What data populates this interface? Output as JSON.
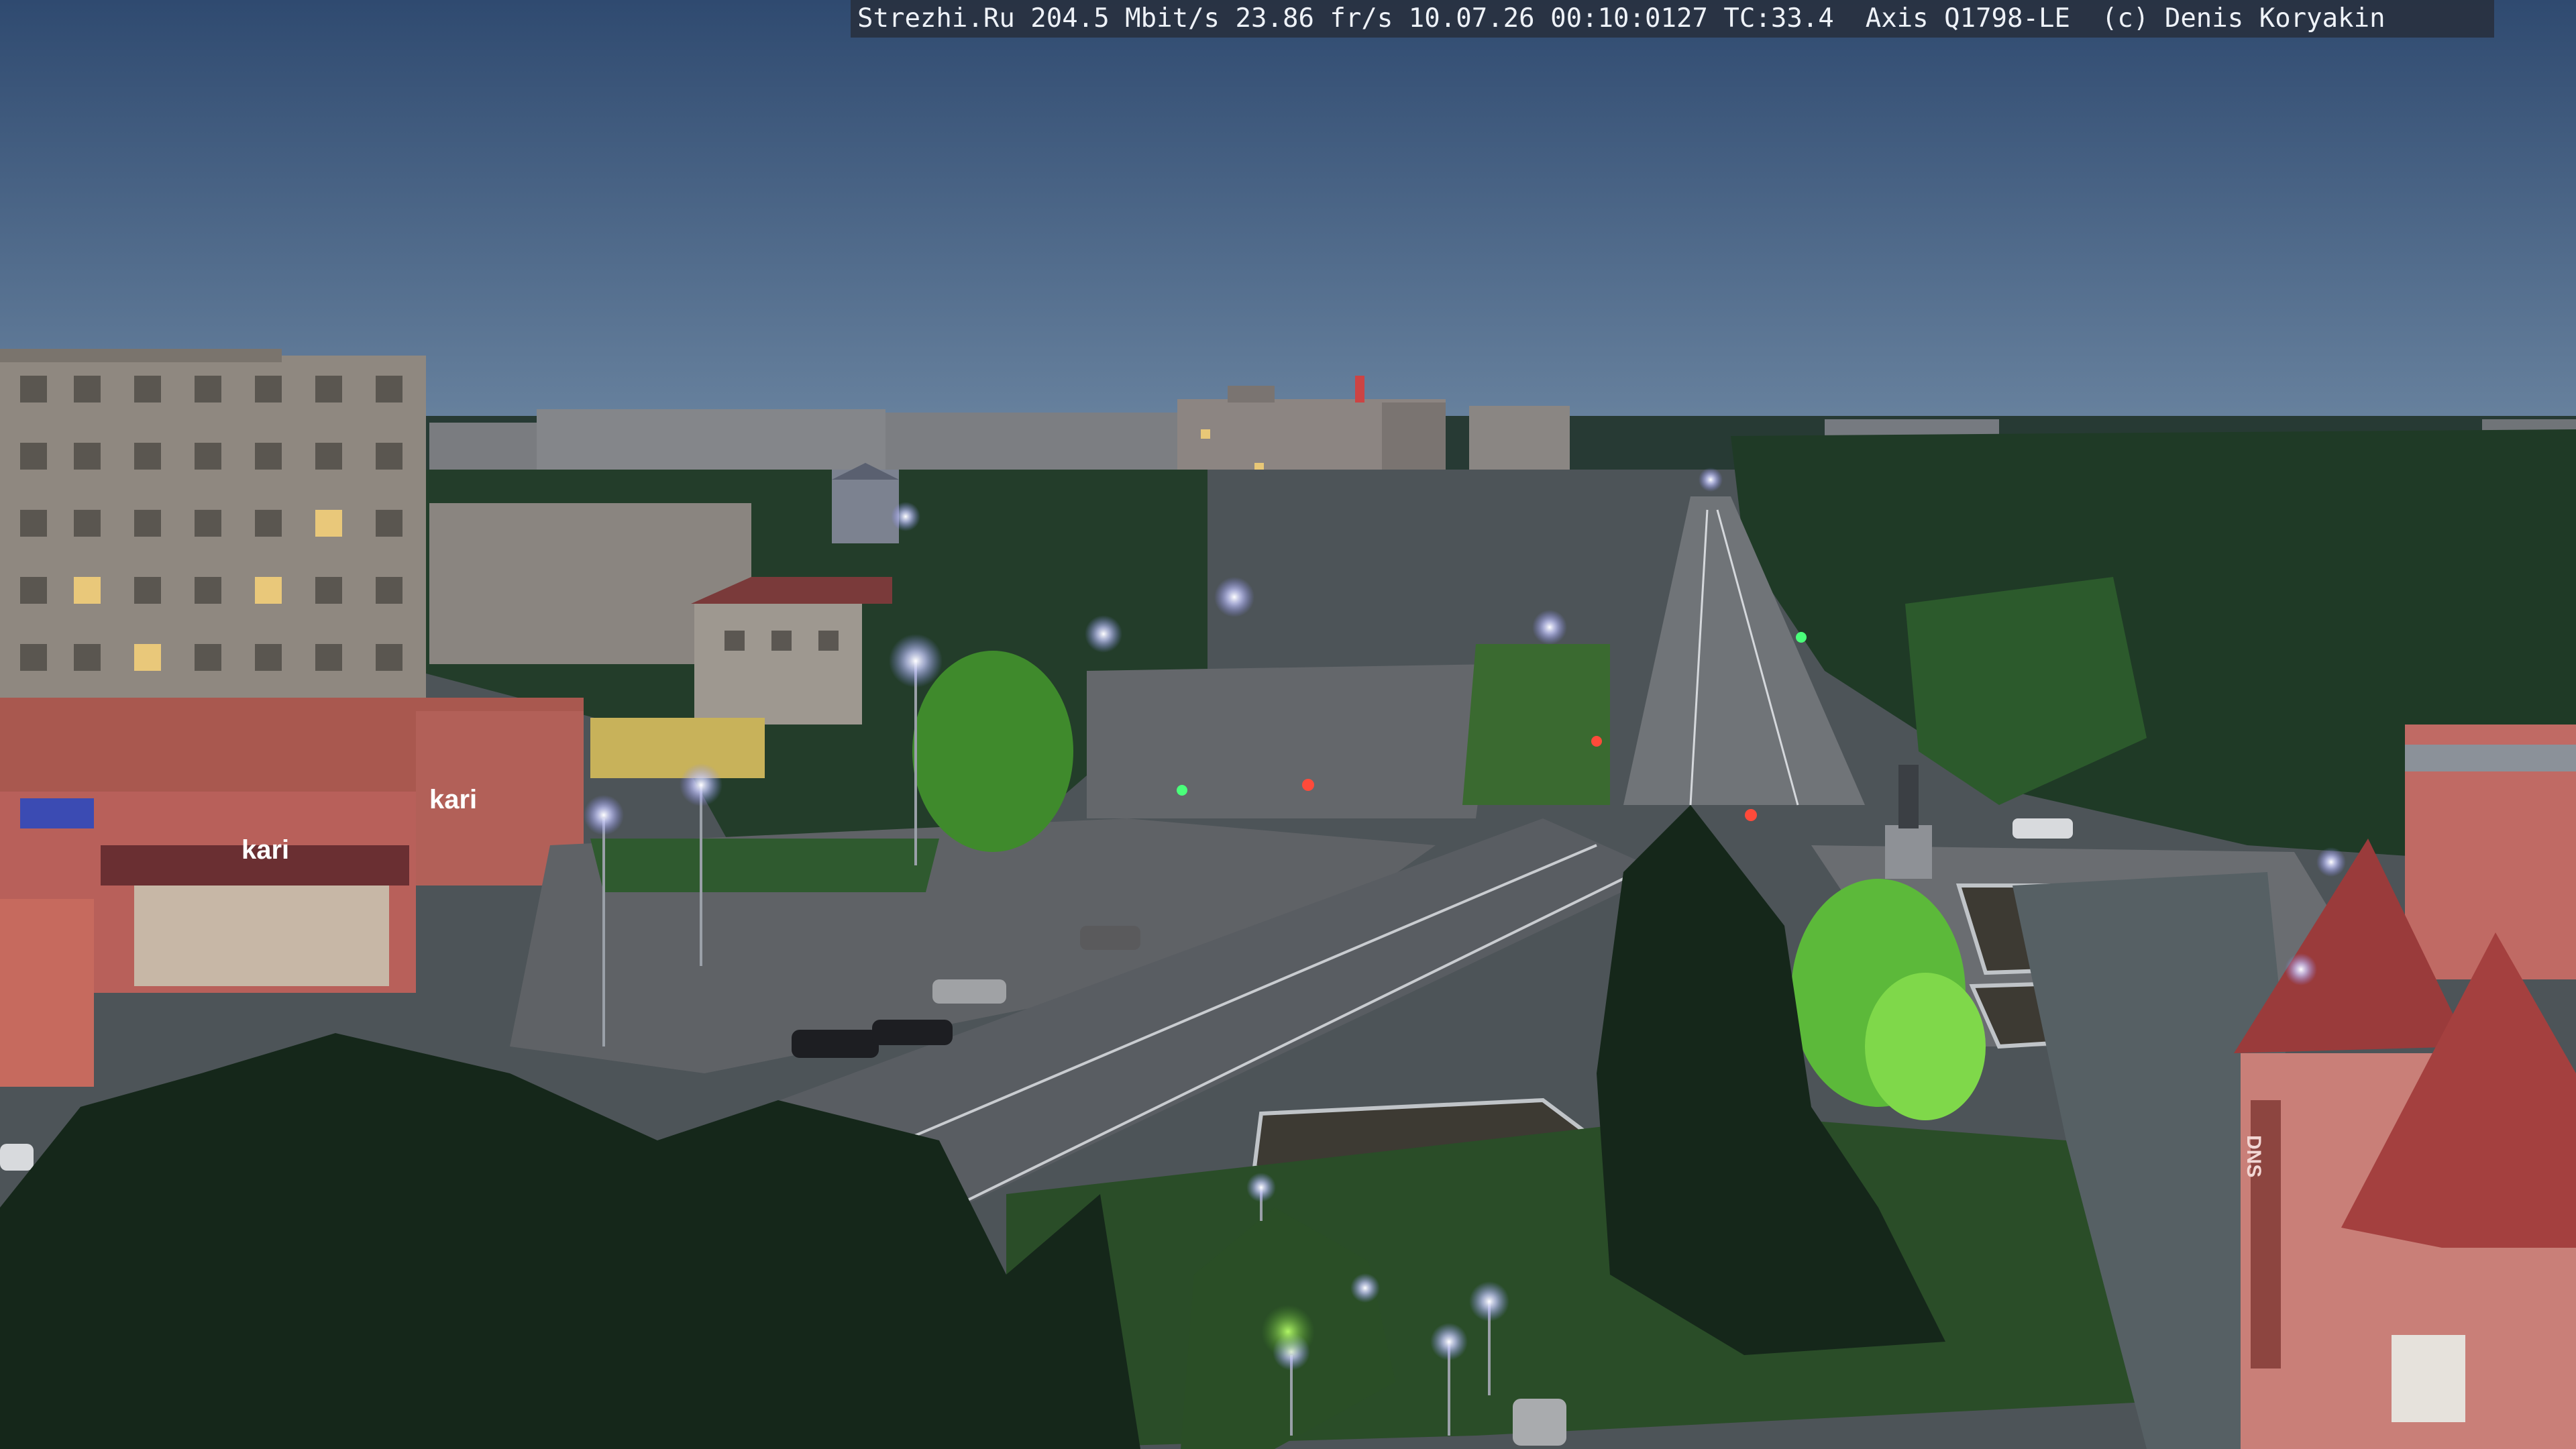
{
  "overlay": {
    "text": "Strezhi.Ru 204.5 Mbit/s 23.86 fr/s 10.07.26 00:10:0127 TC:33.4  Axis Q1798-LE  (c) Denis Koryakin"
  },
  "signs": {
    "bank": "",
    "kari_roof": "kari",
    "kari_front": "kari",
    "dns": "DNS"
  },
  "colors": {
    "sky_top": "#2f4a70",
    "sky_bottom": "#5d7896",
    "trees": "#1f3a24",
    "trees_lit": "#7fd84a",
    "asphalt": "#585c62",
    "streetlight": "#d8dcff",
    "red_building": "#b8605a"
  }
}
